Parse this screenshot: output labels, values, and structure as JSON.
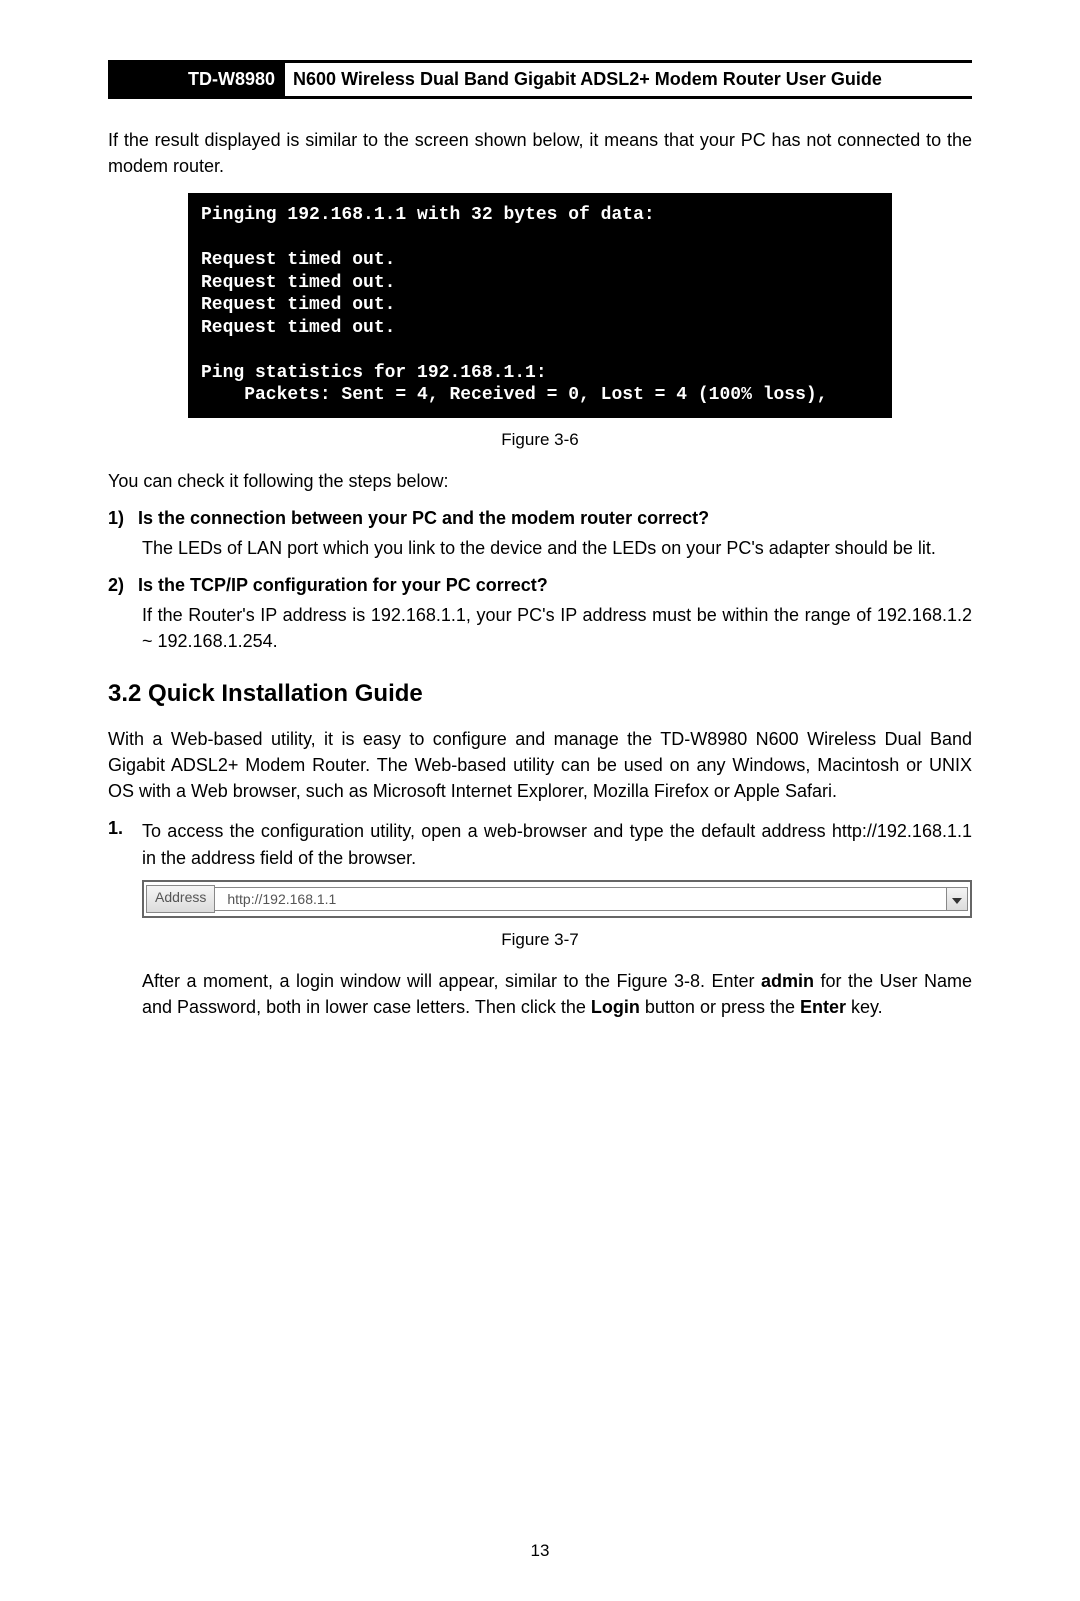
{
  "header": {
    "model": "TD-W8980",
    "title": "N600 Wireless Dual Band Gigabit ADSL2+ Modem Router User Guide"
  },
  "intro": "If the result displayed is similar to the screen shown below, it means that your PC has not connected to the modem router.",
  "terminal": {
    "line1": "Pinging 192.168.1.1 with 32 bytes of data:",
    "blank1": "",
    "r1": "Request timed out.",
    "r2": "Request timed out.",
    "r3": "Request timed out.",
    "r4": "Request timed out.",
    "blank2": "",
    "stats": "Ping statistics for 192.168.1.1:",
    "pkts": "    Packets: Sent = 4, Received = 0, Lost = 4 (100% loss),"
  },
  "figcap1": "Figure 3-6",
  "check_line": "You can check it following the steps below:",
  "q1": {
    "num": "1)",
    "q": "Is the connection between your PC and the modem router correct?",
    "a": "The LEDs of LAN port which you link to the device and the LEDs on your PC's adapter should be lit."
  },
  "q2": {
    "num": "2)",
    "q": "Is the TCP/IP configuration for your PC correct?",
    "a": "If the Router's IP address is 192.168.1.1, your PC's IP address must be within the range of 192.168.1.2 ~ 192.168.1.254."
  },
  "section": "3.2  Quick Installation Guide",
  "para2": "With a Web-based utility, it is easy to configure and manage the TD-W8980 N600 Wireless Dual Band Gigabit ADSL2+ Modem Router. The Web-based utility can be used on any Windows, Macintosh or UNIX OS with a Web browser, such as Microsoft Internet Explorer, Mozilla Firefox or Apple Safari.",
  "step1": {
    "num": "1.",
    "text": "To access the configuration utility, open a web-browser and type the default address http://192.168.1.1 in the address field of the browser."
  },
  "address_bar": {
    "label": "Address",
    "url": "http://192.168.1.1"
  },
  "figcap2": "Figure 3-7",
  "after": {
    "pre": "After a moment, a login window will appear, similar to the Figure 3-8. Enter ",
    "admin": "admin",
    "mid": " for the User Name and Password, both in lower case letters. Then click the ",
    "login": "Login",
    "mid2": " button or press the ",
    "enter": "Enter",
    "end": " key."
  },
  "page_number": "13"
}
